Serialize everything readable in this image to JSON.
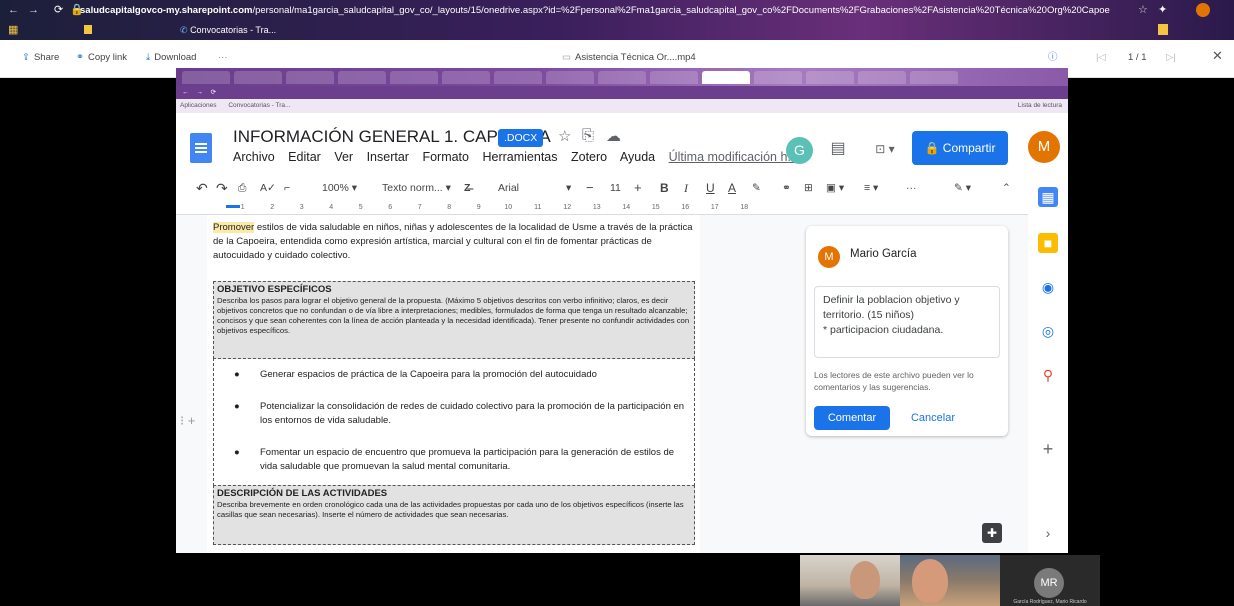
{
  "outer_browser": {
    "url_host": "saludcapitalgovco-my.sharepoint.com",
    "url_path": "/personal/ma1garcia_saludcapital_gov_co/_layouts/15/onedrive.aspx?id=%2Fpersonal%2Fma1garcia_saludcapital_gov_co%2FDocuments%2FGrabaciones%2FAsistencia%20Técnica%20Org%20Capoeira-20...",
    "bookmark": "Convocatorias - Tra..."
  },
  "viewer": {
    "share": "Share",
    "copy_link": "Copy link",
    "download": "Download",
    "more": "···",
    "file_name": "Asistencia Técnica Or....mp4",
    "page_count": "1 / 1"
  },
  "inner_browser": {
    "bookmark": "Convocatorias - Tra...",
    "apps": "Aplicaciones",
    "reading_list": "Lista de lectura"
  },
  "docs": {
    "title": "INFORMACIÓN GENERAL 1. CAPOEIRA",
    "badge": ".DOCX",
    "menu": [
      "Archivo",
      "Editar",
      "Ver",
      "Insertar",
      "Formato",
      "Herramientas",
      "Zotero",
      "Ayuda"
    ],
    "last_edit": "Última modificación h...",
    "share_label": "Compartir",
    "user_initial": "M",
    "toolbar": {
      "zoom": "100%",
      "style": "Texto norm...",
      "font": "Arial",
      "size": "11"
    },
    "ruler": [
      "1",
      "2",
      "3",
      "4",
      "5",
      "6",
      "7",
      "8",
      "9",
      "10",
      "11",
      "12",
      "13",
      "14",
      "15",
      "16",
      "17",
      "18"
    ]
  },
  "content": {
    "intro_highlight": "Promover",
    "intro_rest": " estilos de vida saludable en niños, niñas y adolescentes de la localidad de Usme a través de la práctica de la Capoeira, entendida como expresión artística, marcial y cultural con el fin de fomentar prácticas de autocuidado y cuidado colectivo.",
    "obj_title": "OBJETIVO ESPECÍFICOS",
    "obj_desc": "Describa los pasos para lograr el objetivo general de la propuesta. (Máximo 5 objetivos descritos con verbo infinitivo; claros, es decir objetivos concretos que no confundan o de vía libre a interpretaciones; medibles, formulados de forma que tenga un resultado alcanzable; concisos y que sean coherentes con la línea de acción planteada y la necesidad identificada). Tener presente no confundir actividades con objetivos específicos.",
    "bullets": [
      "Generar espacios de práctica de la Capoeira para la promoción del autocuidado",
      "Potencializar la consolidación de redes de cuidado colectivo para la promoción de la participación en los entornos de vida saludable.",
      "Fomentar un espacio de encuentro que promueva la participación para la generación de estilos de vida saludable que promuevan la salud mental comunitaria."
    ],
    "act_title": "DESCRIPCIÓN DE LAS ACTIVIDADES",
    "act_desc": "Describa brevemente en orden cronológico cada una de las actividades propuestas por cada uno de los objetivos específicos (inserte las casillas que sean necesarias). Inserte el número de actividades que sean necesarias."
  },
  "comment": {
    "author_initial": "M",
    "author": "Mario García",
    "text": "Definir la poblacion objetivo y territorio. (15 niños)\n* participacion ciudadana.",
    "notice": "Los lectores de este archivo pueden ver lo comentarios y las sugerencias.",
    "submit": "Comentar",
    "cancel": "Cancelar"
  },
  "participants": {
    "initials": "MR",
    "name": "García Rodríguez, Mario Ricardo"
  }
}
